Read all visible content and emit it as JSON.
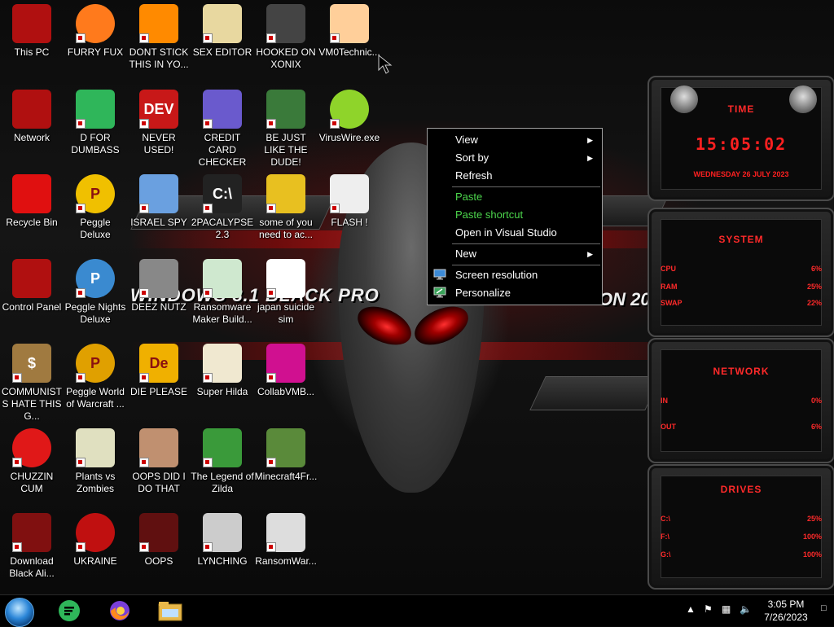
{
  "desktop_icons": [
    {
      "label": "This PC",
      "icon": "monitor-icon"
    },
    {
      "label": "FURRY FUX",
      "icon": "firefox-icon"
    },
    {
      "label": "DONT STICK THIS IN YO...",
      "icon": "vlc-cone-icon"
    },
    {
      "label": "SEX EDITOR",
      "icon": "hxd-icon"
    },
    {
      "label": "HOOKED ON XONIX",
      "icon": "xonix-icon"
    },
    {
      "label": "VM0Technic...",
      "icon": "doctor-icon"
    },
    {
      "label": "Network",
      "icon": "network-icon"
    },
    {
      "label": "D FOR DUMBASS",
      "icon": "discord-like-icon"
    },
    {
      "label": "NEVER USED!",
      "icon": "dev-cpp-icon"
    },
    {
      "label": "CREDIT CARD CHECKER",
      "icon": "credit-card-icon"
    },
    {
      "label": "BE JUST LIKE THE DUDE!",
      "icon": "dude-icon"
    },
    {
      "label": "VirusWire.exe",
      "icon": "lime-icon"
    },
    {
      "label": "Recycle Bin",
      "icon": "recycle-bin-icon"
    },
    {
      "label": "Peggle Deluxe",
      "icon": "peggle-icon"
    },
    {
      "label": "ISRAEL SPY",
      "icon": "spy-icon"
    },
    {
      "label": "2PACALYPSE 2.3",
      "icon": "terminal-icon"
    },
    {
      "label": "some of you need to ac...",
      "icon": "dog-icon"
    },
    {
      "label": "FLASH !",
      "icon": "flash-icon"
    },
    {
      "label": "Control Panel",
      "icon": "control-panel-icon"
    },
    {
      "label": "Peggle Nights Deluxe",
      "icon": "peggle-nights-icon"
    },
    {
      "label": "DEEZ NUTZ",
      "icon": "windows-stack-icon"
    },
    {
      "label": "Ransomware Maker Build...",
      "icon": "app-window-icon"
    },
    {
      "label": "japan suicide sim",
      "icon": "document-icon"
    },
    {
      "label": "COMMUNISTS HATE THIS G...",
      "icon": "money-bag-icon"
    },
    {
      "label": "Peggle World of Warcraft ...",
      "icon": "peggle-wow-icon"
    },
    {
      "label": "DIE PLEASE",
      "icon": "de-icon"
    },
    {
      "label": "Super Hilda",
      "icon": "pixel-game-icon"
    },
    {
      "label": "CollabVMB...",
      "icon": "collabvm-icon"
    },
    {
      "label": "CHUZZIN CUM",
      "icon": "chuzzle-icon"
    },
    {
      "label": "Plants vs Zombies",
      "icon": "pvz-icon"
    },
    {
      "label": "OOPS DID I DO THAT",
      "icon": "portrait-icon"
    },
    {
      "label": "The Legend of Zilda",
      "icon": "zelda-icon"
    },
    {
      "label": "Minecraft4Fr...",
      "icon": "minecraft-icon"
    },
    {
      "label": "Download Black Ali...",
      "icon": "alien-download-icon"
    },
    {
      "label": "UKRAINE",
      "icon": "radiation-icon"
    },
    {
      "label": "OOPS",
      "icon": "alienware-icon"
    },
    {
      "label": "LYNCHING",
      "icon": "gallows-icon"
    },
    {
      "label": "RansomWar...",
      "icon": "skull-icon"
    }
  ],
  "wallpaper": {
    "title_left": "WINDOWS 8.1 BLACK PRO",
    "title_right": "ON 20"
  },
  "context_menu": {
    "items": [
      {
        "label": "View",
        "submenu": true
      },
      {
        "label": "Sort by",
        "submenu": true
      },
      {
        "label": "Refresh"
      },
      {
        "label": "Paste",
        "color": "#4cd64c"
      },
      {
        "label": "Paste shortcut",
        "color": "#4cd64c"
      },
      {
        "label": "Open in Visual Studio"
      },
      {
        "label": "New",
        "submenu": true
      },
      {
        "label": "Screen resolution",
        "icon": "monitor-icon"
      },
      {
        "label": "Personalize",
        "icon": "personalize-icon"
      }
    ]
  },
  "gadget": {
    "time_title": "TIME",
    "time": "15:05:02",
    "date": "WEDNESDAY 26 JULY 2023",
    "system_title": "SYSTEM",
    "cpu_label": "CPU",
    "cpu_value": "6%",
    "ram_label": "RAM",
    "ram_value": "25%",
    "swap_label": "SWAP",
    "swap_value": "22%",
    "network_title": "NETWORK",
    "in_label": "IN",
    "in_value": "0%",
    "out_label": "OUT",
    "out_value": "6%",
    "drives_title": "DRIVES",
    "drive_c_label": "C:\\",
    "drive_c_value": "25%",
    "drive_f_label": "F:\\",
    "drive_f_value": "100%",
    "drive_g_label": "G:\\",
    "drive_g_value": "100%",
    "accent": "#ff2020"
  },
  "taskbar": {
    "clock_time": "3:05 PM",
    "clock_date": "7/26/2023",
    "pinned": [
      "discord-like-icon",
      "firefox-icon",
      "file-explorer-icon"
    ]
  }
}
